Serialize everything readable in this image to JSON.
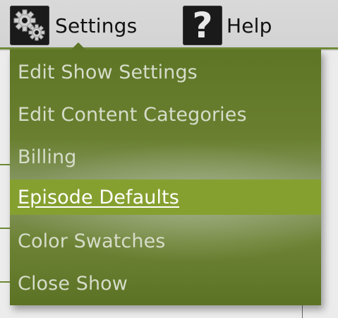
{
  "toolbar": {
    "settings_label": "Settings",
    "help_label": "Help",
    "help_glyph": "?"
  },
  "menu": {
    "items": [
      {
        "label": "Edit Show Settings"
      },
      {
        "label": "Edit Content Categories"
      },
      {
        "label": "Billing"
      },
      {
        "label": "Episode Defaults",
        "active": true
      },
      {
        "label": "Color Swatches"
      },
      {
        "label": "Close Show"
      }
    ]
  },
  "colors": {
    "menu_bg": "#6a8030",
    "menu_active": "#86a030",
    "accent_line": "#6f8a36"
  }
}
